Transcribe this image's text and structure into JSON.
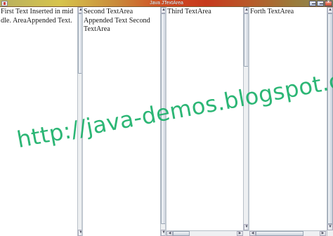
{
  "window": {
    "title": "Java JTextArea"
  },
  "panes": [
    {
      "text": "First Text Inserted in mid\ndle. AreaAppended Text."
    },
    {
      "text": "Second TextArea\nAppended Text Second\nTextArea"
    },
    {
      "text": "Third TextArea"
    },
    {
      "text": "Forth TextArea"
    }
  ],
  "watermark": {
    "text": "http://java-demos.blogspot.com"
  },
  "icons": {
    "app": "app-icon",
    "minimize": "minimize-icon",
    "maximize": "maximize-icon",
    "close": "close-icon",
    "scroll_up": "arrow-up-icon",
    "scroll_down": "arrow-down-icon",
    "scroll_left": "arrow-left-icon",
    "scroll_right": "arrow-right-icon"
  }
}
